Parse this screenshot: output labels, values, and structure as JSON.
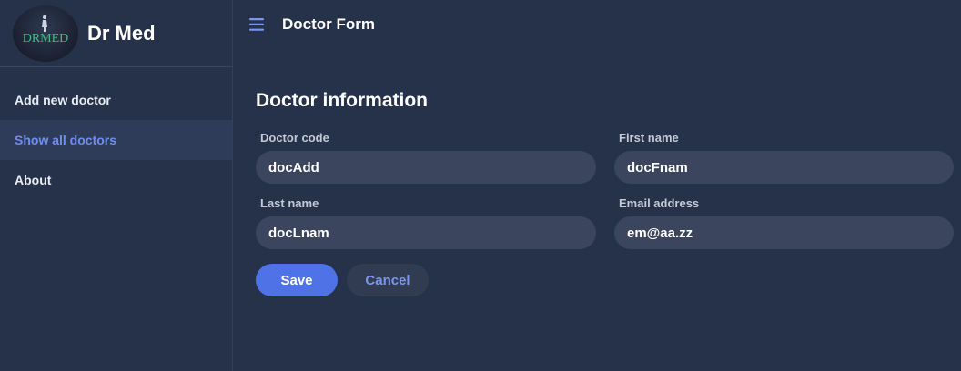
{
  "brand": {
    "name": "Dr Med",
    "logo_text": "DRMED"
  },
  "sidebar": {
    "items": [
      {
        "label": "Add new doctor"
      },
      {
        "label": "Show all doctors"
      },
      {
        "label": "About"
      }
    ]
  },
  "header": {
    "title": "Doctor Form",
    "menu_icon": "hamburger-icon"
  },
  "form": {
    "title": "Doctor information",
    "fields": {
      "doctor_code": {
        "label": "Doctor code",
        "value": "docAdd"
      },
      "first_name": {
        "label": "First name",
        "value": "docFnam"
      },
      "last_name": {
        "label": "Last name",
        "value": "docLnam"
      },
      "email": {
        "label": "Email address",
        "value": "em@aa.zz"
      }
    },
    "save_label": "Save",
    "cancel_label": "Cancel"
  },
  "colors": {
    "background": "#263249",
    "accent": "#4f72e6",
    "active_nav_text": "#6f8ff0",
    "input_bg": "#3b465e"
  }
}
